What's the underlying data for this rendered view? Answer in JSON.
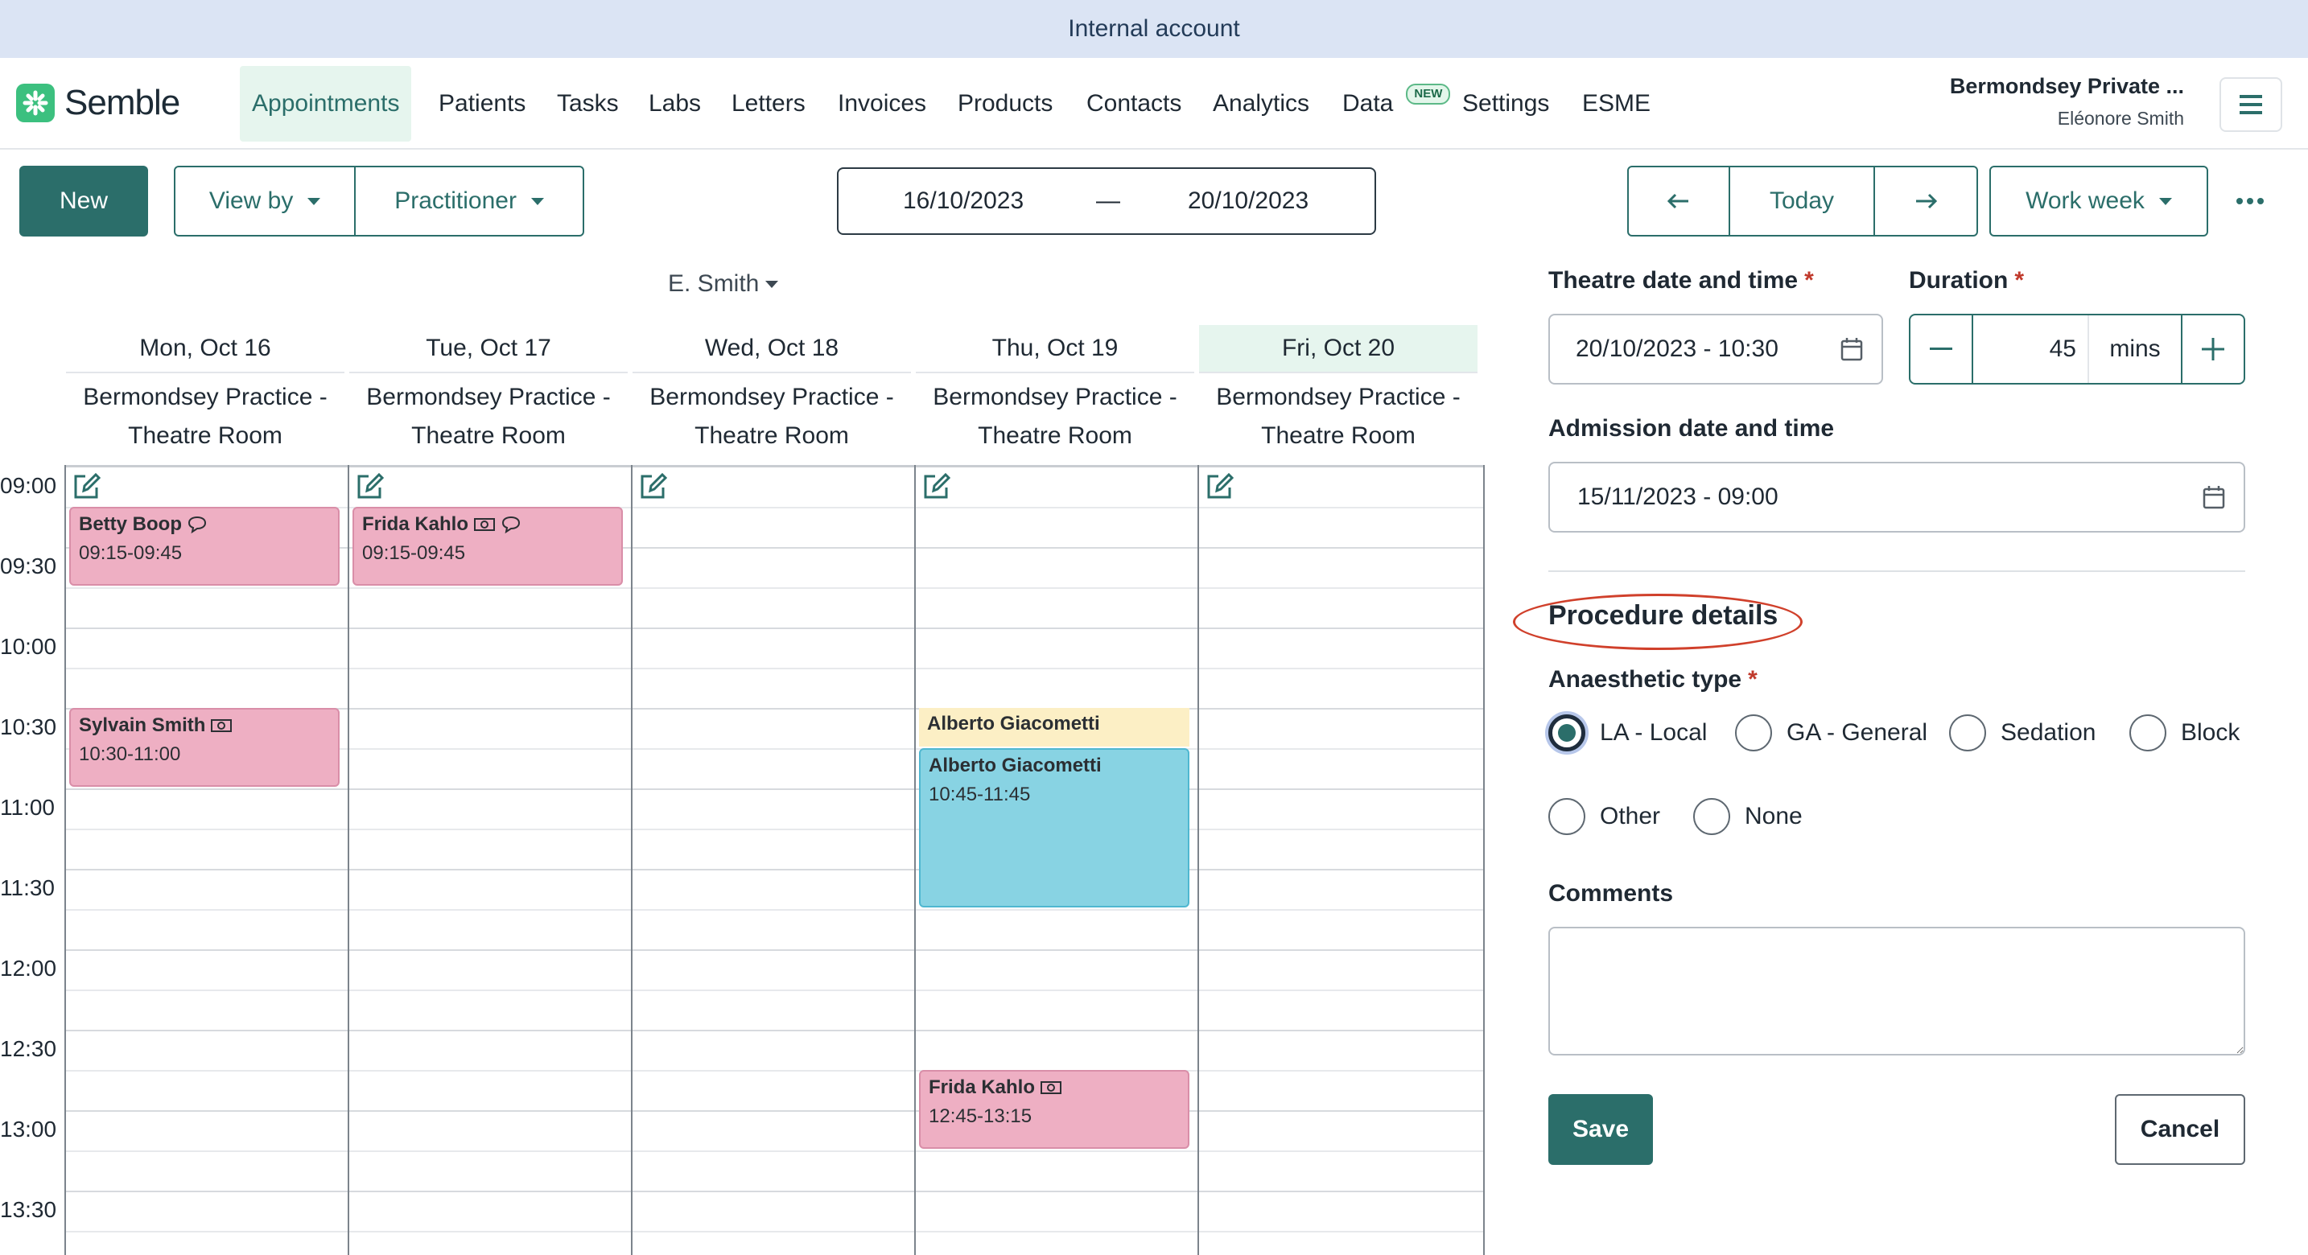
{
  "banner": {
    "text": "Internal account"
  },
  "nav": {
    "logo_text": "Semble",
    "items": [
      {
        "label": "Appointments",
        "active": true
      },
      {
        "label": "Patients"
      },
      {
        "label": "Tasks"
      },
      {
        "label": "Labs"
      },
      {
        "label": "Letters"
      },
      {
        "label": "Invoices"
      },
      {
        "label": "Products"
      },
      {
        "label": "Contacts"
      },
      {
        "label": "Analytics"
      },
      {
        "label": "Data",
        "badge": "NEW"
      },
      {
        "label": "Settings"
      },
      {
        "label": "ESME"
      }
    ],
    "practice": "Bermondsey Private ...",
    "user": "Eléonore Smith",
    "menu_icon": "hamburger-icon"
  },
  "toolbar": {
    "new_label": "New",
    "view_by_label": "View by",
    "practitioner_label": "Practitioner",
    "date_start": "16/10/2023",
    "date_sep": "—",
    "date_end": "20/10/2023",
    "prev_icon": "arrow-left-icon",
    "today_label": "Today",
    "next_icon": "arrow-right-icon",
    "range_label": "Work week",
    "more_icon": "ellipsis-icon"
  },
  "calendar": {
    "practitioner": "E. Smith",
    "days": [
      {
        "label": "Mon, Oct 16",
        "room1": "Bermondsey Practice -",
        "room2": "Theatre Room"
      },
      {
        "label": "Tue, Oct 17",
        "room1": "Bermondsey Practice -",
        "room2": "Theatre Room"
      },
      {
        "label": "Wed, Oct 18",
        "room1": "Bermondsey Practice -",
        "room2": "Theatre Room"
      },
      {
        "label": "Thu, Oct 19",
        "room1": "Bermondsey Practice -",
        "room2": "Theatre Room"
      },
      {
        "label": "Fri, Oct 20",
        "room1": "Bermondsey Practice -",
        "room2": "Theatre Room",
        "today": true
      }
    ],
    "times": [
      "09:00",
      "09:30",
      "10:00",
      "10:30",
      "11:00",
      "11:30",
      "12:00",
      "12:30",
      "13:00",
      "13:30"
    ],
    "appointments": [
      {
        "name": "Betty Boop",
        "time": "09:15-09:45",
        "icons": [
          "comment-icon"
        ]
      },
      {
        "name": "Frida Kahlo",
        "time": "09:15-09:45",
        "icons": [
          "cash-icon",
          "comment-icon"
        ]
      },
      {
        "name": "Sylvain Smith",
        "time": "10:30-11:00",
        "icons": [
          "cash-icon"
        ]
      },
      {
        "name": "Alberto Giacometti"
      },
      {
        "name": "Alberto Giacometti",
        "time": "10:45-11:45"
      },
      {
        "name": "Frida Kahlo",
        "time": "12:45-13:15",
        "icons": [
          "cash-icon"
        ]
      }
    ],
    "colors": {
      "pink": "#eeafc3",
      "blue": "#88d3e3",
      "yellow": "#fcefc5",
      "today": "#e6f5ee"
    }
  },
  "form": {
    "theatre_label": "Theatre date and time",
    "theatre_value": "20/10/2023 - 10:30",
    "duration_label": "Duration",
    "duration_value": "45",
    "duration_unit": "mins",
    "admission_label": "Admission date and time",
    "admission_value": "15/11/2023 - 09:00",
    "section_title": "Procedure details",
    "anaesthetic_label": "Anaesthetic type",
    "anaesthetic_options": [
      "LA - Local",
      "GA - General",
      "Sedation",
      "Block",
      "Other",
      "None"
    ],
    "anaesthetic_selected": "LA - Local",
    "comments_label": "Comments",
    "comments_value": "",
    "save_label": "Save",
    "cancel_label": "Cancel",
    "required_mark": "*"
  },
  "theme": {
    "primary": "#2b6e6a",
    "required": "#c0392b",
    "highlight_ring": "#d0402b"
  }
}
